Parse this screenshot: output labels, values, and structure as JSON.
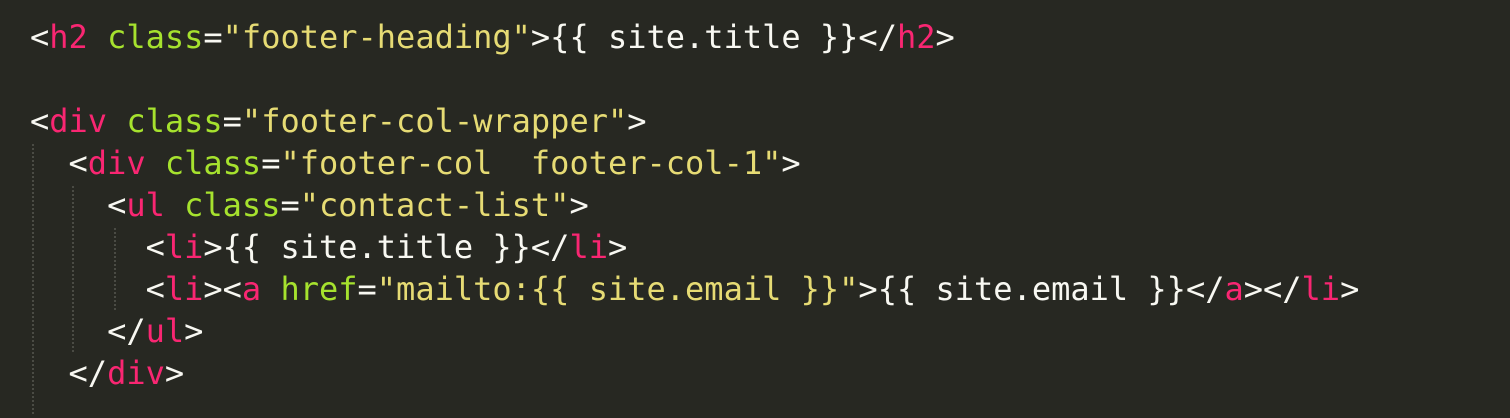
{
  "editor": {
    "theme_colors": {
      "background": "#272822",
      "punctuation": "#f8f8f2",
      "tag": "#f92672",
      "attribute": "#a6e22e",
      "string": "#e6db74",
      "text": "#f8f8f2"
    },
    "lines": [
      {
        "tokens": [
          {
            "text": "<",
            "type": "punct"
          },
          {
            "text": "h2",
            "type": "tag"
          },
          {
            "text": " class",
            "type": "attr"
          },
          {
            "text": "=",
            "type": "punct"
          },
          {
            "text": "\"footer-heading\"",
            "type": "string"
          },
          {
            "text": ">{{ site.title }}</",
            "type": "text"
          },
          {
            "text": "h2",
            "type": "tag"
          },
          {
            "text": ">",
            "type": "punct"
          }
        ]
      },
      {
        "tokens": []
      },
      {
        "tokens": [
          {
            "text": "<",
            "type": "punct"
          },
          {
            "text": "div",
            "type": "tag"
          },
          {
            "text": " class",
            "type": "attr"
          },
          {
            "text": "=",
            "type": "punct"
          },
          {
            "text": "\"footer-col-wrapper\"",
            "type": "string"
          },
          {
            "text": ">",
            "type": "punct"
          }
        ]
      },
      {
        "tokens": [
          {
            "text": "  <",
            "type": "punct"
          },
          {
            "text": "div",
            "type": "tag"
          },
          {
            "text": " class",
            "type": "attr"
          },
          {
            "text": "=",
            "type": "punct"
          },
          {
            "text": "\"footer-col  footer-col-1\"",
            "type": "string"
          },
          {
            "text": ">",
            "type": "punct"
          }
        ]
      },
      {
        "tokens": [
          {
            "text": "    <",
            "type": "punct"
          },
          {
            "text": "ul",
            "type": "tag"
          },
          {
            "text": " class",
            "type": "attr"
          },
          {
            "text": "=",
            "type": "punct"
          },
          {
            "text": "\"contact-list\"",
            "type": "string"
          },
          {
            "text": ">",
            "type": "punct"
          }
        ]
      },
      {
        "tokens": [
          {
            "text": "      <",
            "type": "punct"
          },
          {
            "text": "li",
            "type": "tag"
          },
          {
            "text": ">{{ site.title }}</",
            "type": "text"
          },
          {
            "text": "li",
            "type": "tag"
          },
          {
            "text": ">",
            "type": "punct"
          }
        ]
      },
      {
        "tokens": [
          {
            "text": "      <",
            "type": "punct"
          },
          {
            "text": "li",
            "type": "tag"
          },
          {
            "text": "><",
            "type": "punct"
          },
          {
            "text": "a",
            "type": "tag"
          },
          {
            "text": " href",
            "type": "attr"
          },
          {
            "text": "=",
            "type": "punct"
          },
          {
            "text": "\"mailto:{{ site.email }}\"",
            "type": "string"
          },
          {
            "text": ">{{ site.email }}</",
            "type": "text"
          },
          {
            "text": "a",
            "type": "tag"
          },
          {
            "text": "></",
            "type": "punct"
          },
          {
            "text": "li",
            "type": "tag"
          },
          {
            "text": ">",
            "type": "punct"
          }
        ]
      },
      {
        "tokens": [
          {
            "text": "    </",
            "type": "punct"
          },
          {
            "text": "ul",
            "type": "tag"
          },
          {
            "text": ">",
            "type": "punct"
          }
        ]
      },
      {
        "tokens": [
          {
            "text": "  </",
            "type": "punct"
          },
          {
            "text": "div",
            "type": "tag"
          },
          {
            "text": ">",
            "type": "punct"
          }
        ]
      }
    ]
  }
}
